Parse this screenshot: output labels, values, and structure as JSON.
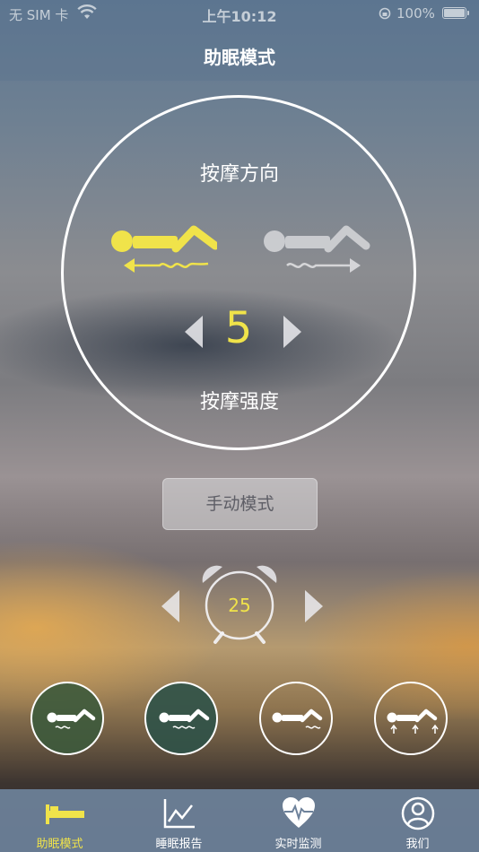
{
  "status_bar": {
    "carrier": "无 SIM 卡",
    "time": "上午10:12",
    "battery": "100%"
  },
  "header": {
    "title": "助眠模式"
  },
  "massage": {
    "direction_label": "按摩方向",
    "strength_label": "按摩强度",
    "strength_value": "5",
    "selected_direction": "head-to-foot",
    "active_color": "#f0e34a"
  },
  "manual_button": {
    "label": "手动模式"
  },
  "timer": {
    "value": "25"
  },
  "modes": [
    {
      "icon": "lying-wave-icon",
      "fill": "#3d5a3c"
    },
    {
      "icon": "lying-wave-icon",
      "fill": "#2f5248"
    },
    {
      "icon": "lying-wave-icon",
      "fill": "none"
    },
    {
      "icon": "lying-arrows-icon",
      "fill": "none"
    }
  ],
  "tabs": [
    {
      "label": "助眠模式",
      "icon": "bed-icon",
      "active": true
    },
    {
      "label": "睡眠报告",
      "icon": "chart-icon",
      "active": false
    },
    {
      "label": "实时监测",
      "icon": "heartbeat-icon",
      "active": false
    },
    {
      "label": "我们",
      "icon": "user-icon",
      "active": false
    }
  ],
  "colors": {
    "accent": "#f0e34a",
    "inactive": "#ffffff"
  }
}
